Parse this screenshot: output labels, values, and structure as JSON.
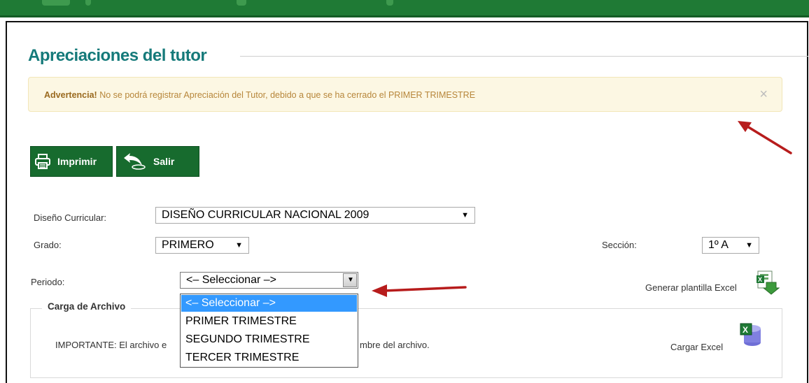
{
  "page": {
    "title": "Apreciaciones del tutor"
  },
  "alert": {
    "strong": "Advertencia!",
    "message": " No se podrá registrar Apreciación del Tutor, debido a que se ha cerrado el PRIMER TRIMESTRE",
    "close_symbol": "×"
  },
  "toolbar": {
    "print_label": "Imprimir",
    "exit_label": "Salir"
  },
  "form": {
    "diseno_label": "Diseño Curricular:",
    "diseno_value": "DISEÑO CURRICULAR NACIONAL 2009",
    "grado_label": "Grado:",
    "grado_value": "PRIMERO",
    "seccion_label": "Sección:",
    "seccion_value": "1º A",
    "periodo_label": "Periodo:",
    "periodo_value": "<– Seleccionar –>",
    "periodo_options": [
      "<– Seleccionar –>",
      "PRIMER TRIMESTRE",
      "SEGUNDO TRIMESTRE",
      "TERCER TRIMESTRE"
    ]
  },
  "actions": {
    "generate_template": "Generar plantilla Excel",
    "load_excel": "Cargar Excel"
  },
  "upload": {
    "legend": "Carga de Archivo",
    "note_start": "IMPORTANTE: El archivo e",
    "note_end": "mbre del archivo."
  },
  "colors": {
    "brand_green": "#176b2e",
    "title_teal": "#157a7a",
    "alert_bg": "#fcf7e3",
    "alert_text": "#b7863a",
    "arrow_red": "#b71c1c",
    "selected_option": "#3399ff"
  },
  "icons": {
    "print": "printer-icon",
    "exit": "back-arrow-icon",
    "close": "close-icon",
    "excel_generate": "excel-download-icon",
    "excel_load": "excel-database-icon"
  }
}
